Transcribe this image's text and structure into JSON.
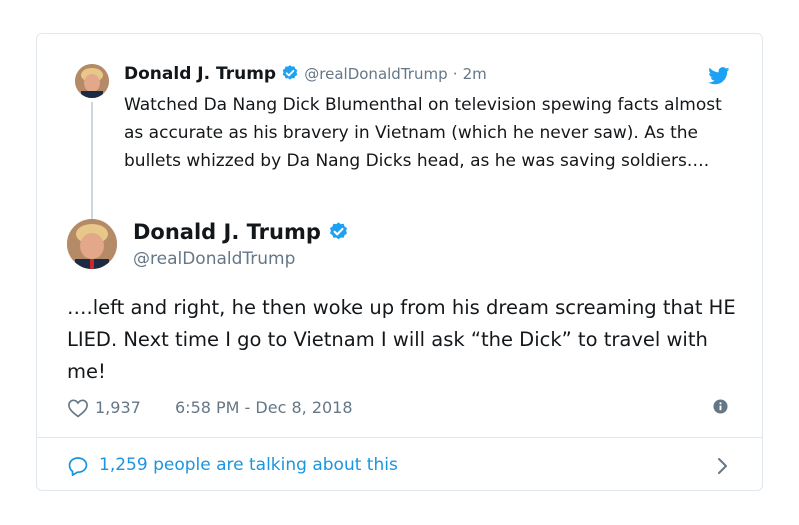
{
  "parent_tweet": {
    "author_name": "Donald J. Trump",
    "handle": "@realDonaldTrump",
    "separator": "·",
    "time_ago": "2m",
    "text": "Watched Da Nang Dick Blumenthal on television spewing facts almost as accurate as his bravery in Vietnam (which he never saw). As the bullets whizzed by Da Nang Dicks head, as he was saving soldiers….",
    "avatar_icon": "avatar-portrait"
  },
  "main_tweet": {
    "author_name": "Donald J. Trump",
    "handle": "@realDonaldTrump",
    "text": "….left and right, he then woke up from his dream screaming that HE LIED. Next time I go to Vietnam I will ask “the Dick” to travel with me!",
    "like_count": "1,937",
    "timestamp": "6:58 PM - Dec 8, 2018"
  },
  "footer": {
    "talking_text": "1,259 people are talking about this"
  },
  "icons": {
    "verified": "verified-badge-icon",
    "brand": "twitter-bird-icon",
    "like": "heart-icon",
    "info": "info-icon",
    "reply_bubble": "speech-bubble-icon",
    "chevron": "chevron-right-icon"
  },
  "colors": {
    "accent": "#1da1f2",
    "link": "#1b95e0",
    "text": "#14171a",
    "muted": "#657786",
    "border": "#e1e8ed"
  }
}
